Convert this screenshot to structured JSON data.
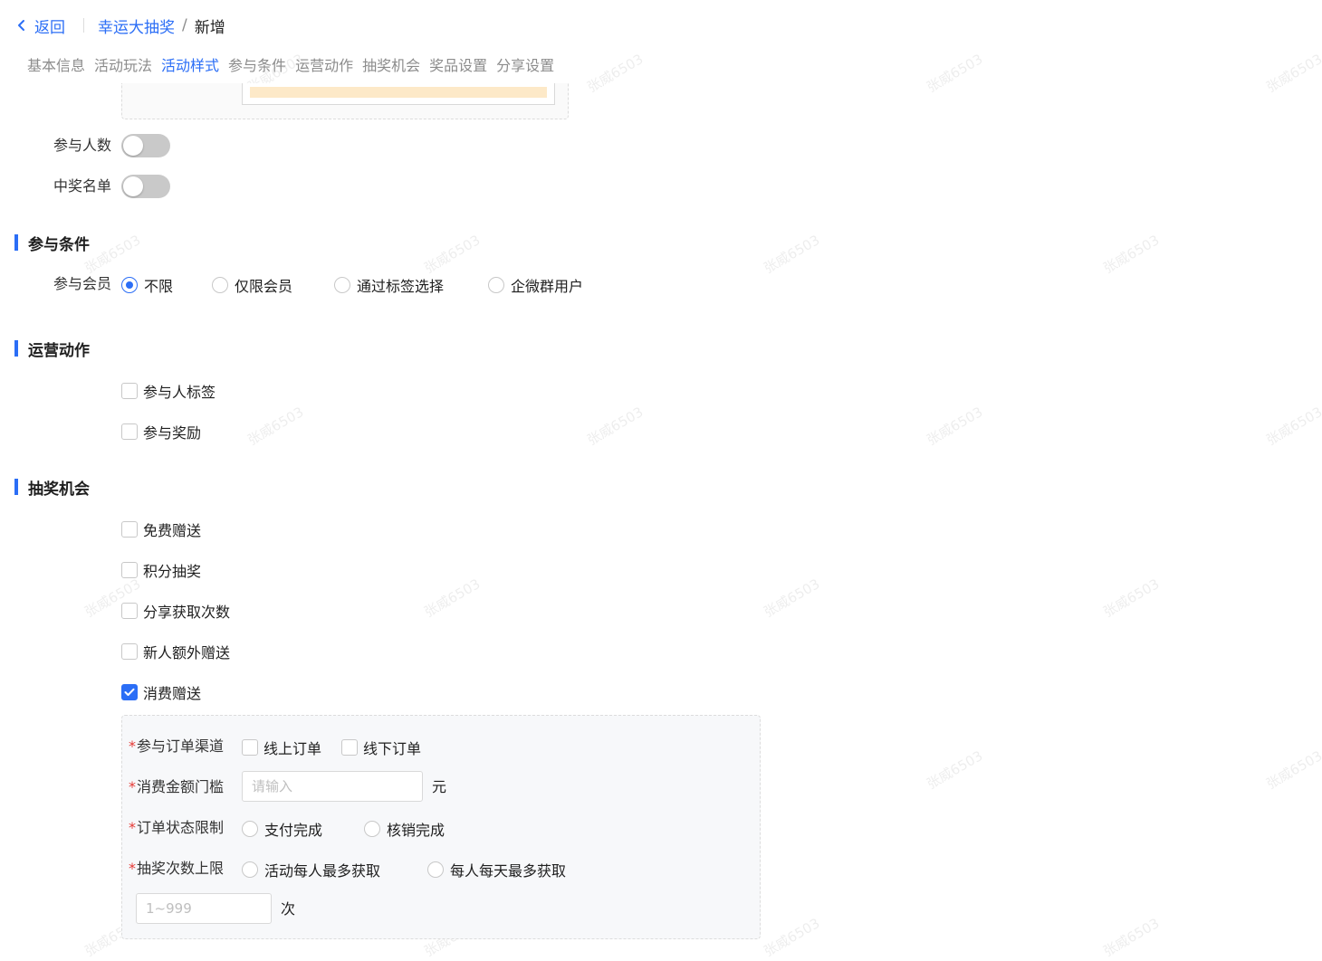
{
  "header": {
    "back_label": "返回",
    "breadcrumb_parent": "幸运大抽奖",
    "breadcrumb_separator": "/",
    "breadcrumb_current": "新增"
  },
  "tabs": [
    {
      "label": "基本信息",
      "active": false
    },
    {
      "label": "活动玩法",
      "active": false
    },
    {
      "label": "活动样式",
      "active": true
    },
    {
      "label": "参与条件",
      "active": false
    },
    {
      "label": "运营动作",
      "active": false
    },
    {
      "label": "抽奖机会",
      "active": false
    },
    {
      "label": "奖品设置",
      "active": false
    },
    {
      "label": "分享设置",
      "active": false
    }
  ],
  "style_settings": {
    "participants_label": "参与人数",
    "participants_on": false,
    "winners_label": "中奖名单",
    "winners_on": false
  },
  "conditions": {
    "title": "参与条件",
    "member_label": "参与会员",
    "options": [
      "不限",
      "仅限会员",
      "通过标签选择",
      "企微群用户"
    ],
    "selected_index": 0
  },
  "operations": {
    "title": "运营动作",
    "items": [
      {
        "label": "参与人标签",
        "checked": false
      },
      {
        "label": "参与奖励",
        "checked": false
      }
    ]
  },
  "chances": {
    "title": "抽奖机会",
    "items": [
      {
        "label": "免费赠送",
        "checked": false
      },
      {
        "label": "积分抽奖",
        "checked": false
      },
      {
        "label": "分享获取次数",
        "checked": false
      },
      {
        "label": "新人额外赠送",
        "checked": false
      },
      {
        "label": "消费赠送",
        "checked": true
      }
    ]
  },
  "consumption": {
    "required_mark": "*",
    "channel_label": "参与订单渠道",
    "channel_options": [
      {
        "label": "线上订单",
        "checked": false
      },
      {
        "label": "线下订单",
        "checked": false
      }
    ],
    "amount_label": "消费金额门槛",
    "amount_placeholder": "请输入",
    "amount_unit": "元",
    "status_label": "订单状态限制",
    "status_options": [
      "支付完成",
      "核销完成"
    ],
    "limit_label": "抽奖次数上限",
    "limit_options": [
      "活动每人最多获取",
      "每人每天最多获取"
    ],
    "limit_placeholder": "1~999",
    "limit_unit": "次"
  },
  "watermark_text": "张威6503",
  "colors": {
    "accent": "#2b6ef6",
    "required": "#e53935",
    "switch_off": "#c9c9c9"
  }
}
